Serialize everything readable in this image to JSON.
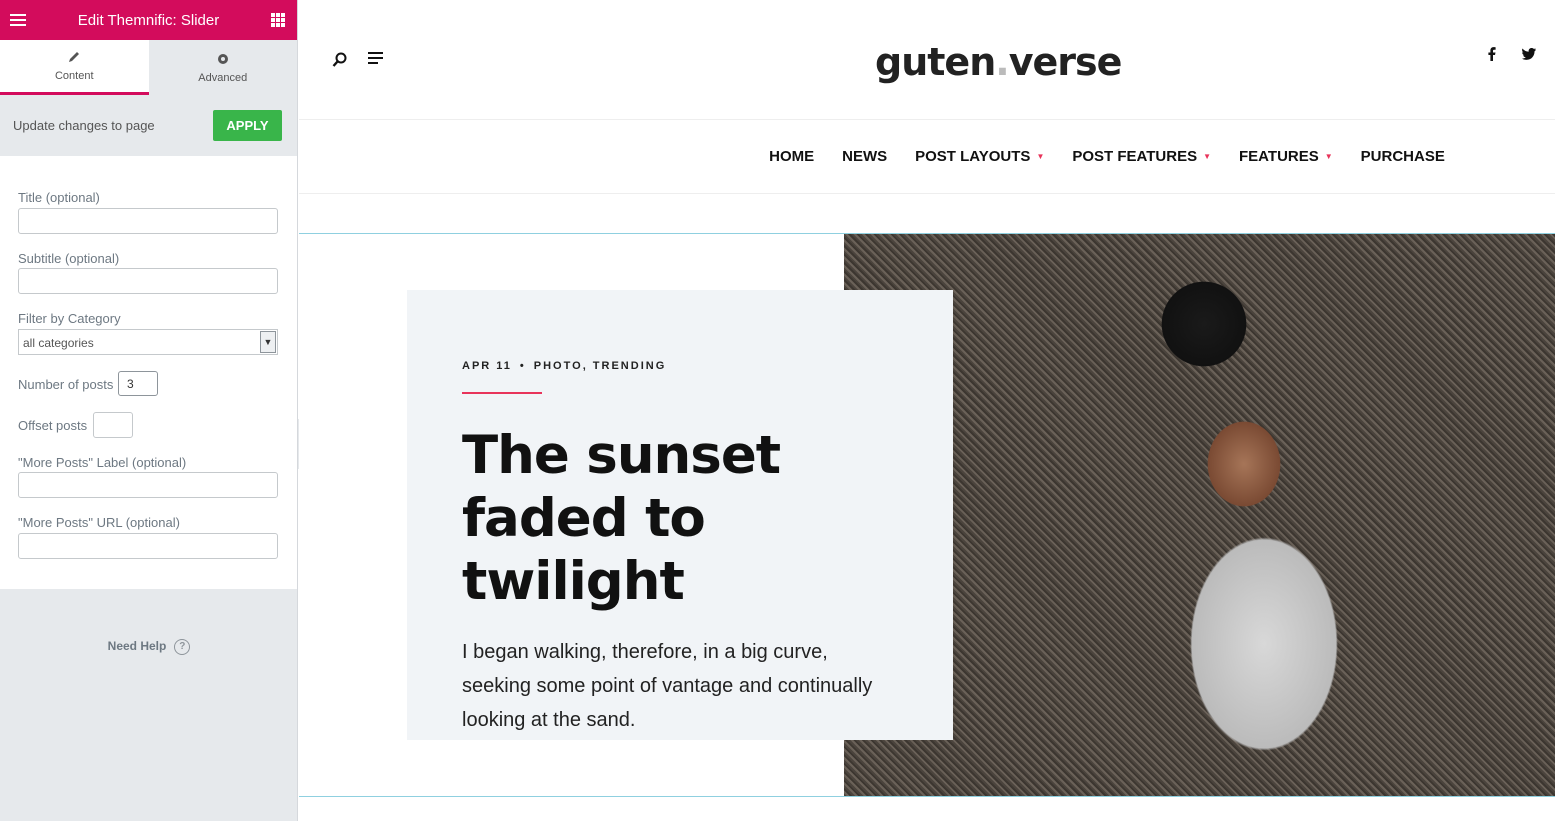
{
  "panel": {
    "title": "Edit Themnific: Slider",
    "tabs": [
      {
        "label": "Content"
      },
      {
        "label": "Advanced"
      }
    ],
    "update_text": "Update changes to page",
    "apply_label": "APPLY",
    "fields": {
      "title_label": "Title (optional)",
      "subtitle_label": "Subtitle (optional)",
      "category_label": "Filter by Category",
      "category_value": "all categories",
      "num_posts_label": "Number of posts",
      "num_posts_value": "3",
      "offset_label": "Offset posts",
      "more_label_label": "\"More Posts\" Label (optional)",
      "more_url_label": "\"More Posts\" URL (optional)"
    },
    "help": "Need Help",
    "accent": "#d30c5c"
  },
  "site": {
    "logo_left": "guten",
    "logo_dot": ".",
    "logo_right": "verse",
    "nav": [
      {
        "label": "HOME"
      },
      {
        "label": "NEWS"
      },
      {
        "label": "POST LAYOUTS"
      },
      {
        "label": "POST FEATURES"
      },
      {
        "label": "FEATURES"
      },
      {
        "label": "PURCHASE"
      }
    ],
    "hero": {
      "date": "APR 11",
      "bullet": "•",
      "categories": "PHOTO, TRENDING",
      "headline": "The sunset faded to twilight",
      "excerpt": "I began walking, therefore, in a big curve, seeking some point of vantage and continually looking at the sand."
    }
  }
}
